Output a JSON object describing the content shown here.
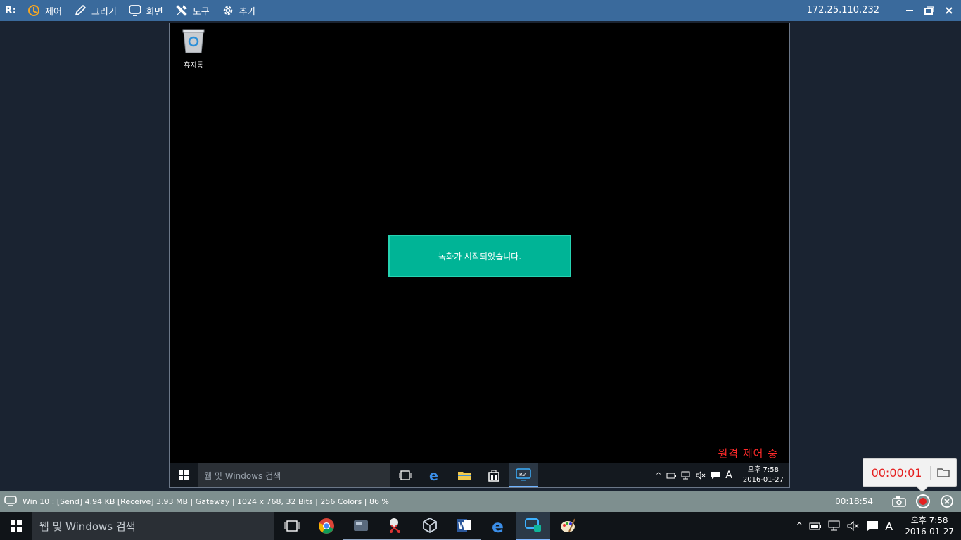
{
  "toolbar": {
    "logo": "R:",
    "menus": [
      {
        "label": "제어",
        "icon": "control-icon"
      },
      {
        "label": "그리기",
        "icon": "pencil-icon"
      },
      {
        "label": "화면",
        "icon": "monitor-icon"
      },
      {
        "label": "도구",
        "icon": "tools-icon"
      },
      {
        "label": "추가",
        "icon": "gear-icon"
      }
    ],
    "ip": "172.25.110.232"
  },
  "remote": {
    "recycle_bin_label": "휴지통",
    "toast": "녹화가 시작되었습니다.",
    "remote_control_label": "원격 제어 중",
    "taskbar": {
      "search_placeholder": "웹 및 Windows 검색",
      "time": "오후 7:58",
      "date": "2016-01-27",
      "ime": "A",
      "active_app": "RV"
    }
  },
  "status": {
    "info": "Win 10 : [Send] 4.94 KB  [Receive] 3.93 MB | Gateway | 1024 x 768, 32 Bits | 256 Colors | 86 %",
    "elapsed": "00:18:54"
  },
  "recording_popup": {
    "timer": "00:00:01"
  },
  "host_taskbar": {
    "search_placeholder": "웹 및 Windows 검색",
    "time": "오후 7:58",
    "date": "2016-01-27",
    "ime": "A"
  },
  "colors": {
    "toolbar_bg": "#3a6a9c",
    "toast_bg": "#00b496",
    "record_red": "#e52020",
    "status_bg": "#7e8f8f"
  }
}
